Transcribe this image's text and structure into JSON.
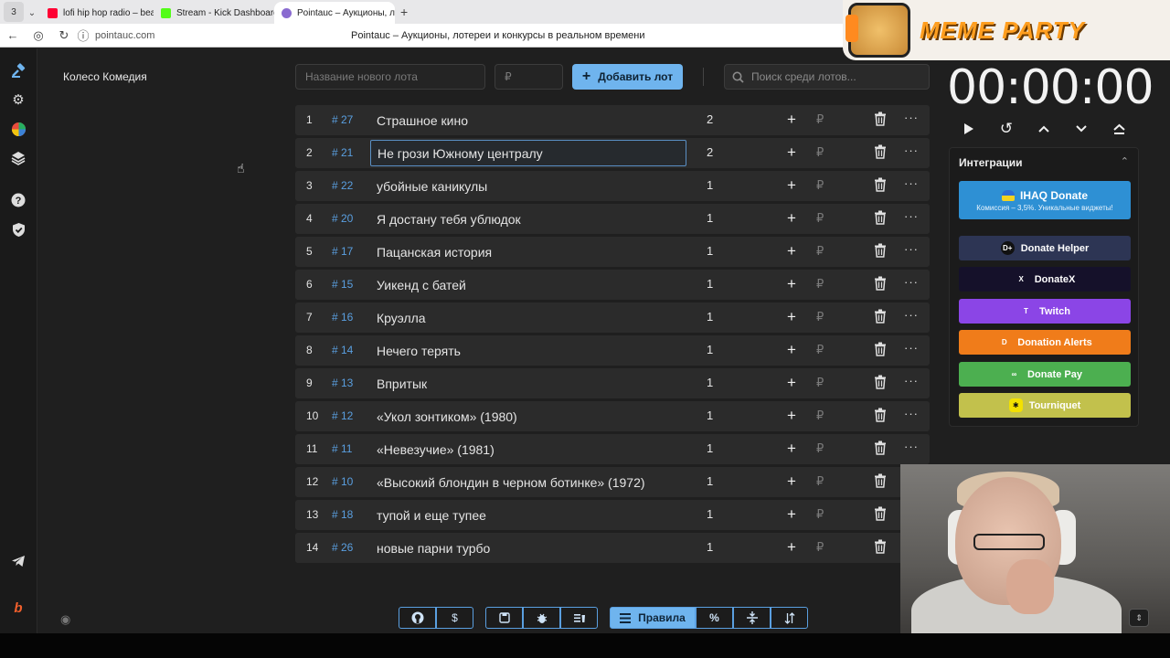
{
  "browser": {
    "tab_count": "3",
    "tabs": [
      {
        "title": "lofi hip hop radio – beats to",
        "fav_color": "#ff0033"
      },
      {
        "title": "Stream - Kick Dashboard",
        "fav_color": "#53fc18"
      },
      {
        "title": "Pointauc – Аукционы, л",
        "fav_color": "#8a6bd0"
      }
    ],
    "url": "pointauc.com",
    "page_title": "Pointauc – Аукционы, лотереи и конкурсы в реальном времени"
  },
  "overlay": {
    "text": "MEME PARTY"
  },
  "wheel": {
    "title": "Колесо Комедия"
  },
  "form": {
    "new_lot_placeholder": "Название нового лота",
    "amount_placeholder": "₽",
    "add_label": "Добавить лот",
    "search_placeholder": "Поиск среди лотов..."
  },
  "lots": [
    {
      "num": "1",
      "tag": "# 27",
      "name": "Страшное кино",
      "amount": "2"
    },
    {
      "num": "2",
      "tag": "# 21",
      "name": "Не грози Южному централу",
      "amount": "2",
      "editing": true
    },
    {
      "num": "3",
      "tag": "# 22",
      "name": "убойные каникулы",
      "amount": "1"
    },
    {
      "num": "4",
      "tag": "# 20",
      "name": "Я достану тебя ублюдок",
      "amount": "1"
    },
    {
      "num": "5",
      "tag": "# 17",
      "name": "Пацанская история",
      "amount": "1"
    },
    {
      "num": "6",
      "tag": "# 15",
      "name": "Уикенд с батей",
      "amount": "1"
    },
    {
      "num": "7",
      "tag": "# 16",
      "name": "Круэлла",
      "amount": "1"
    },
    {
      "num": "8",
      "tag": "# 14",
      "name": "Нечего терять",
      "amount": "1"
    },
    {
      "num": "9",
      "tag": "# 13",
      "name": "Впритык",
      "amount": "1"
    },
    {
      "num": "10",
      "tag": "# 12",
      "name": "«Укол зонтиком» (1980)",
      "amount": "1"
    },
    {
      "num": "11",
      "tag": "# 11",
      "name": "«Невезучие» (1981)",
      "amount": "1"
    },
    {
      "num": "12",
      "tag": "# 10",
      "name": " «Высокий блондин в черном ботинке» (1972)",
      "amount": "1"
    },
    {
      "num": "13",
      "tag": "# 18",
      "name": "тупой и еще тупее",
      "amount": "1"
    },
    {
      "num": "14",
      "tag": "# 26",
      "name": "новые парни турбо",
      "amount": "1"
    }
  ],
  "row_symbols": {
    "plus": "+",
    "currency": "₽",
    "more": "···"
  },
  "timer": {
    "display": "00:00:00"
  },
  "integrations": {
    "title": "Интеграции",
    "ihaq": {
      "name": "IHAQ Donate",
      "desc": "Комиссия – 3,5%. Уникальные виджеты!",
      "color": "#2e90d4"
    },
    "services": [
      {
        "name": "Donate Helper",
        "color": "#2d3554",
        "icon": "D+",
        "icon_bg": "#111"
      },
      {
        "name": "DonateX",
        "color": "#15112a",
        "icon": "X",
        "icon_bg": "transparent"
      },
      {
        "name": "Twitch",
        "color": "#8b45e6",
        "icon": "T",
        "icon_bg": "transparent"
      },
      {
        "name": "Donation Alerts",
        "color": "#f07c1a",
        "icon": "D",
        "icon_bg": "transparent"
      },
      {
        "name": "Donate Pay",
        "color": "#4caf50",
        "icon": "∞",
        "icon_bg": "transparent"
      },
      {
        "name": "Tourniquet",
        "color": "#c2c14c",
        "icon": "✱",
        "icon_bg": "#111"
      }
    ]
  },
  "bottombar": {
    "rules_label": "Правила"
  }
}
